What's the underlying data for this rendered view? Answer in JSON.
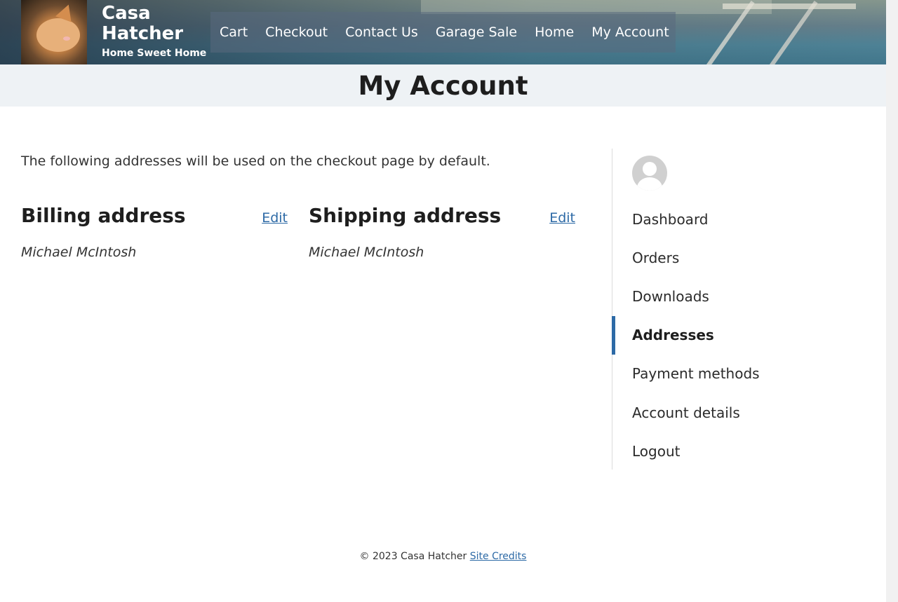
{
  "header": {
    "site_title": "Casa Hatcher",
    "tagline": "Home Sweet Home",
    "nav": [
      "Cart",
      "Checkout",
      "Contact Us",
      "Garage Sale",
      "Home",
      "My Account"
    ]
  },
  "page": {
    "title": "My Account"
  },
  "main": {
    "intro": "The following addresses will be used on the checkout page by default.",
    "billing": {
      "heading": "Billing address",
      "edit_label": "Edit",
      "name": "Michael McIntosh"
    },
    "shipping": {
      "heading": "Shipping address",
      "edit_label": "Edit",
      "name": "Michael McIntosh"
    }
  },
  "sidebar": {
    "items": [
      "Dashboard",
      "Orders",
      "Downloads",
      "Addresses",
      "Payment methods",
      "Account details",
      "Logout"
    ],
    "active": "Addresses"
  },
  "footer": {
    "copyright": "© 2023 Casa Hatcher",
    "credits_link": "Site Credits"
  },
  "colors": {
    "link": "#2d6aa6",
    "title_band": "#eef2f5"
  }
}
